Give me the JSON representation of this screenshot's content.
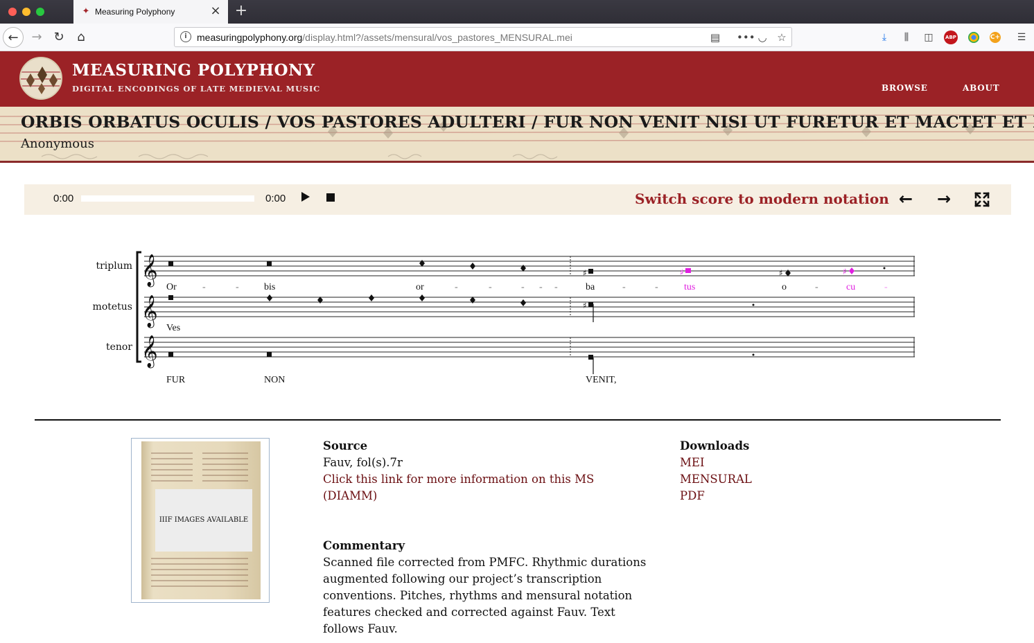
{
  "browser": {
    "tab_title": "Measuring Polyphony",
    "url_host": "measuringpolyphony.org",
    "url_path": "/display.html?/assets/mensural/vos_pastores_MENSURAL.mei"
  },
  "site": {
    "title": "MEASURING POLYPHONY",
    "subtitle": "DIGITAL ENCODINGS OF LATE MEDIEVAL MUSIC",
    "nav": {
      "browse": "BROWSE",
      "about": "ABOUT"
    },
    "brand_color": "#9b2226"
  },
  "piece": {
    "title": "ORBIS ORBATUS OCULIS / VOS PASTORES ADULTERI / FUR NON VENIT NISI UT FURETUR ET MACTET ET PERDAT",
    "composer": "Anonymous"
  },
  "player": {
    "current_time": "0:00",
    "total_time": "0:00",
    "progress_fraction": 0,
    "switch_label": "Switch score to modern notation",
    "prev_icon": "arrow-left-icon",
    "next_icon": "arrow-right-icon",
    "fullscreen_icon": "fullscreen-icon"
  },
  "score": {
    "voices": [
      {
        "name": "triplum",
        "syllables": [
          "Or",
          "-",
          "-",
          "bis",
          "or",
          "-",
          "-",
          "-",
          "-",
          "-",
          "ba",
          "-",
          "-",
          "tus",
          "o",
          "-",
          "cu",
          "-"
        ]
      },
      {
        "name": "motetus",
        "syllables": [
          "Ves"
        ]
      },
      {
        "name": "tenor",
        "syllables": [
          "FUR",
          "NON",
          "VENIT,"
        ]
      }
    ],
    "highlight_color": "#e020e0"
  },
  "info": {
    "source_heading": "Source",
    "source_value": "Fauv, fol(s).7r",
    "source_link_line1": "Click this link for more information on this MS",
    "source_link_line2": "(DIAMM)",
    "downloads_heading": "Downloads",
    "downloads": [
      "MEI",
      "MENSURAL",
      "PDF"
    ],
    "commentary_heading": "Commentary",
    "commentary_lines": [
      "Scanned file corrected from PMFC. Rhythmic durations",
      "augmented following our project’s transcription",
      "conventions. Pitches, rhythms and mensural notation",
      "features checked and corrected against Fauv. Text",
      "follows Fauv."
    ],
    "iiif_label": "IIIF IMAGES AVAILABLE"
  }
}
